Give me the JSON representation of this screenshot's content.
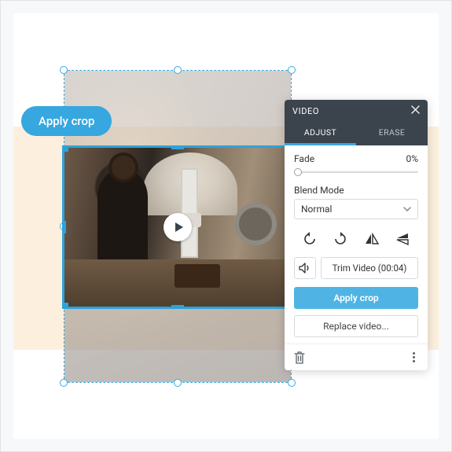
{
  "tooltip": {
    "apply_crop": "Apply crop"
  },
  "panel": {
    "title": "VIDEO",
    "tabs": {
      "adjust": "ADJUST",
      "erase": "ERASE"
    },
    "fade": {
      "label": "Fade",
      "value_text": "0%"
    },
    "blend": {
      "label": "Blend Mode",
      "selected": "Normal"
    },
    "icons": {
      "rotate_left": "rotate-left-icon",
      "rotate_right": "rotate-right-icon",
      "flip_h": "flip-horizontal-icon",
      "flip_v": "flip-vertical-icon"
    },
    "audio_label": "Audio",
    "trim_label": "Trim Video (00:04)",
    "apply_crop_btn": "Apply crop",
    "replace_btn": "Replace video...",
    "delete_label": "Delete",
    "more_label": "More"
  },
  "colors": {
    "accent": "#36a7df",
    "panel_header": "#3b434c"
  }
}
